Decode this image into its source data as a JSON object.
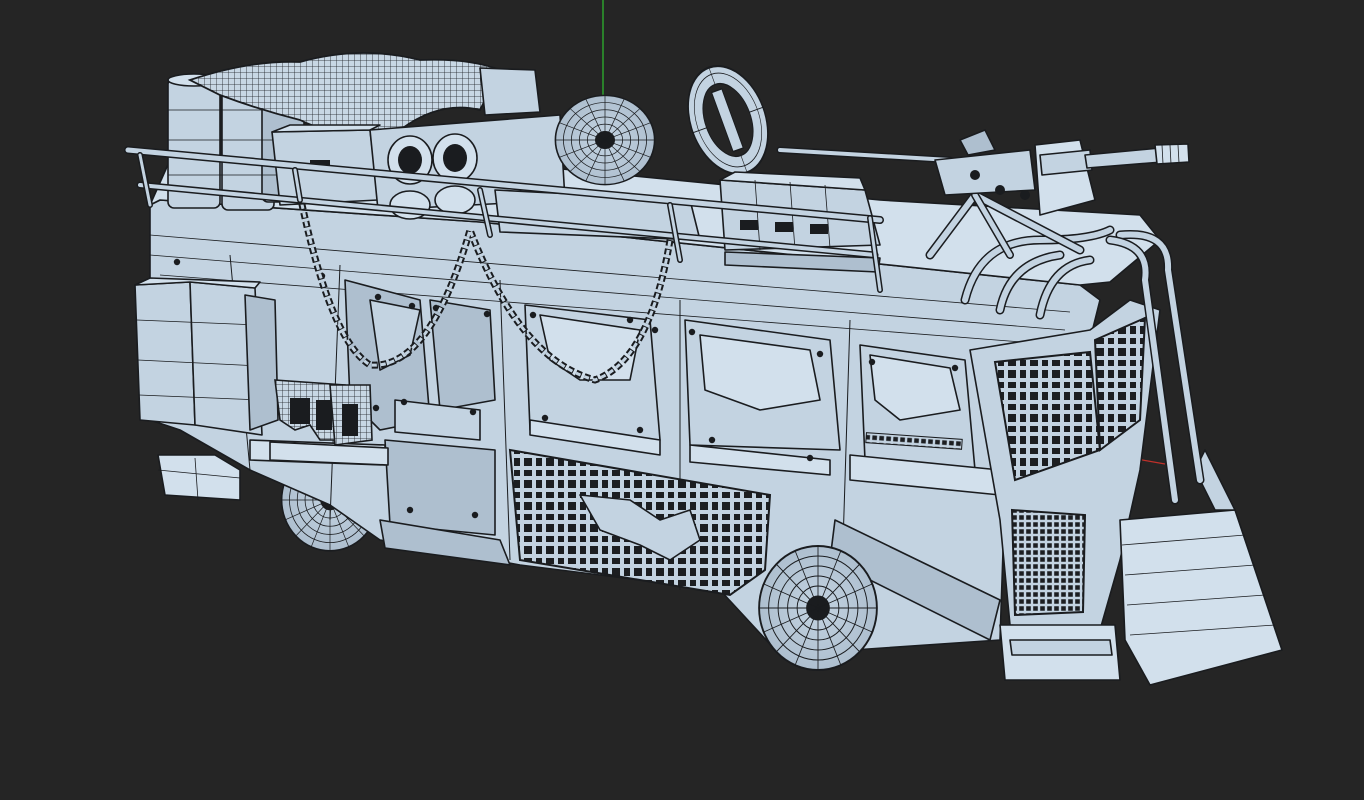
{
  "viewport": {
    "background_color": "#252525",
    "mesh_color": "#c3d3e1",
    "wire_color": "#1a1c1f",
    "axis_y_color": "#2fbf2f",
    "axis_x_color": "#c0302a"
  },
  "scene": {
    "object": "armored-bus-wireframe-model"
  }
}
